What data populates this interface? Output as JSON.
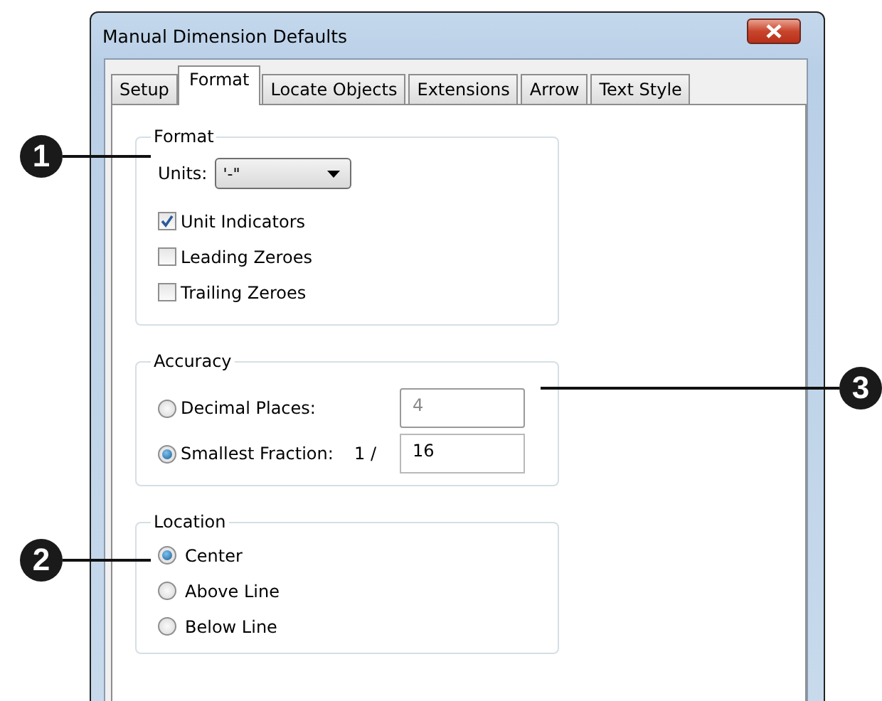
{
  "window": {
    "title": "Manual Dimension Defaults"
  },
  "tabs": [
    {
      "label": "Setup",
      "selected": false
    },
    {
      "label": "Format",
      "selected": true
    },
    {
      "label": "Locate Objects",
      "selected": false
    },
    {
      "label": "Extensions",
      "selected": false
    },
    {
      "label": "Arrow",
      "selected": false
    },
    {
      "label": "Text Style",
      "selected": false
    }
  ],
  "format_group": {
    "title": "Format",
    "units_label": "Units:",
    "units_value": "'-\"",
    "checkboxes": [
      {
        "label": "Unit Indicators",
        "checked": true
      },
      {
        "label": "Leading Zeroes",
        "checked": false
      },
      {
        "label": "Trailing Zeroes",
        "checked": false
      }
    ]
  },
  "accuracy_group": {
    "title": "Accuracy",
    "options": [
      {
        "label": "Decimal Places:",
        "selected": false,
        "value": "4",
        "disabled": true
      },
      {
        "label": "Smallest Fraction:",
        "prefix": "1 /",
        "selected": true,
        "value": "16",
        "disabled": false
      }
    ]
  },
  "location_group": {
    "title": "Location",
    "options": [
      {
        "label": "Center",
        "selected": true
      },
      {
        "label": "Above Line",
        "selected": false
      },
      {
        "label": "Below Line",
        "selected": false
      }
    ]
  },
  "callouts": [
    {
      "number": "1"
    },
    {
      "number": "2"
    },
    {
      "number": "3"
    }
  ]
}
